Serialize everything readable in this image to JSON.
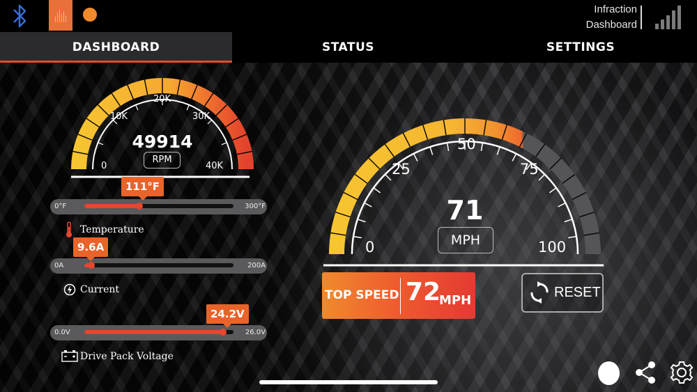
{
  "topbar": {
    "bluetooth_icon": "bluetooth-icon",
    "app_icon": "equalizer-app-icon",
    "status_dot_color": "#f28a2c",
    "title_line1": "Infraction",
    "title_line2": "Dashboard",
    "signal_icon": "signal-bars-icon"
  },
  "tabs": [
    {
      "label": "DASHBOARD",
      "active": true
    },
    {
      "label": "STATUS",
      "active": false
    },
    {
      "label": "SETTINGS",
      "active": false
    }
  ],
  "rpm_gauge": {
    "value": "49914",
    "unit": "RPM",
    "ticks": [
      "0",
      "10K",
      "20K",
      "30K",
      "40K"
    ]
  },
  "sliders": [
    {
      "name": "temperature",
      "label": "Temperature",
      "value_text": "111°F",
      "min": "0°F",
      "max": "300°F",
      "fraction": 0.37,
      "icon": "thermometer-icon"
    },
    {
      "name": "current",
      "label": "Current",
      "value_text": "9.6A",
      "min": "0A",
      "max": "200A",
      "fraction": 0.048,
      "icon": "lightning-bolt-icon"
    },
    {
      "name": "voltage",
      "label": "Drive Pack Voltage",
      "value_text": "24.2V",
      "min": "0.0V",
      "max": "26.0V",
      "fraction": 0.93,
      "icon": "battery-icon"
    }
  ],
  "speed_gauge": {
    "value": "71",
    "unit": "MPH",
    "ticks": [
      "0",
      "25",
      "50",
      "75",
      "100"
    ]
  },
  "top_speed": {
    "label": "TOP SPEED",
    "value": "72",
    "unit": "MPH"
  },
  "reset": {
    "label": "RESET",
    "icon": "refresh-icon"
  },
  "colors": {
    "accent": "#e8642a",
    "tab_underline": "#e34b2b",
    "gauge_yellow": "#f7c531",
    "gauge_red": "#e3422c"
  }
}
